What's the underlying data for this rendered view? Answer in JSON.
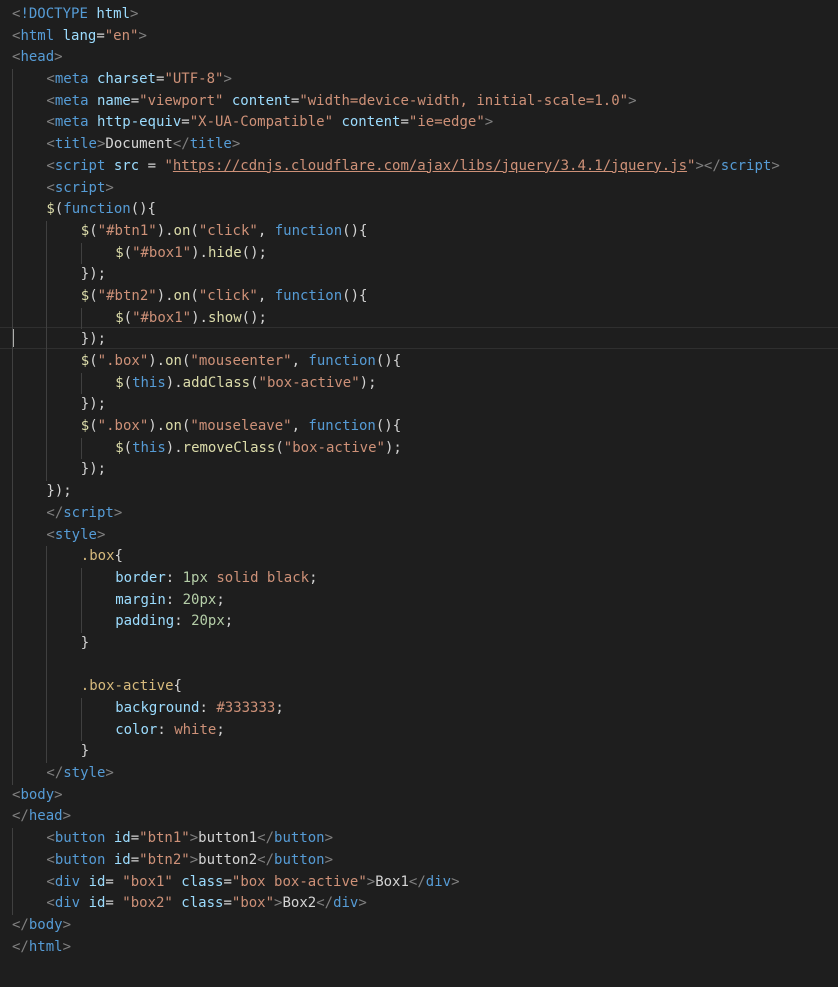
{
  "editor": {
    "language": "html",
    "theme_colors": {
      "background": "#1e1e1e",
      "tag": "#569cd6",
      "bracket": "#808080",
      "attribute": "#9cdcfe",
      "string": "#ce9178",
      "function": "#dcdcaa",
      "keyword": "#569cd6",
      "selector": "#d7ba7d",
      "number": "#b5cea8",
      "text": "#d4d4d4"
    },
    "lines": [
      {
        "indent": 0,
        "tokens": [
          [
            "brk",
            "<"
          ],
          [
            "doc",
            "!DOCTYPE"
          ],
          [
            "txt",
            " "
          ],
          [
            "attr",
            "html"
          ],
          [
            "brk",
            ">"
          ]
        ]
      },
      {
        "indent": 0,
        "tokens": [
          [
            "brk",
            "<"
          ],
          [
            "tag",
            "html"
          ],
          [
            "txt",
            " "
          ],
          [
            "attr",
            "lang"
          ],
          [
            "punc",
            "="
          ],
          [
            "str",
            "\"en\""
          ],
          [
            "brk",
            ">"
          ]
        ]
      },
      {
        "indent": 0,
        "tokens": [
          [
            "brk",
            "<"
          ],
          [
            "tag",
            "head"
          ],
          [
            "brk",
            ">"
          ]
        ]
      },
      {
        "indent": 1,
        "tokens": [
          [
            "brk",
            "<"
          ],
          [
            "tag",
            "meta"
          ],
          [
            "txt",
            " "
          ],
          [
            "attr",
            "charset"
          ],
          [
            "punc",
            "="
          ],
          [
            "str",
            "\"UTF-8\""
          ],
          [
            "brk",
            ">"
          ]
        ]
      },
      {
        "indent": 1,
        "tokens": [
          [
            "brk",
            "<"
          ],
          [
            "tag",
            "meta"
          ],
          [
            "txt",
            " "
          ],
          [
            "attr",
            "name"
          ],
          [
            "punc",
            "="
          ],
          [
            "str",
            "\"viewport\""
          ],
          [
            "txt",
            " "
          ],
          [
            "attr",
            "content"
          ],
          [
            "punc",
            "="
          ],
          [
            "str",
            "\"width=device-width, initial-scale=1.0\""
          ],
          [
            "brk",
            ">"
          ]
        ]
      },
      {
        "indent": 1,
        "tokens": [
          [
            "brk",
            "<"
          ],
          [
            "tag",
            "meta"
          ],
          [
            "txt",
            " "
          ],
          [
            "attr",
            "http-equiv"
          ],
          [
            "punc",
            "="
          ],
          [
            "str",
            "\"X-UA-Compatible\""
          ],
          [
            "txt",
            " "
          ],
          [
            "attr",
            "content"
          ],
          [
            "punc",
            "="
          ],
          [
            "str",
            "\"ie=edge\""
          ],
          [
            "brk",
            ">"
          ]
        ]
      },
      {
        "indent": 1,
        "tokens": [
          [
            "brk",
            "<"
          ],
          [
            "tag",
            "title"
          ],
          [
            "brk",
            ">"
          ],
          [
            "txt",
            "Document"
          ],
          [
            "brk",
            "</"
          ],
          [
            "tag",
            "title"
          ],
          [
            "brk",
            ">"
          ]
        ]
      },
      {
        "indent": 1,
        "tokens": [
          [
            "brk",
            "<"
          ],
          [
            "tag",
            "script"
          ],
          [
            "txt",
            " "
          ],
          [
            "attr",
            "src"
          ],
          [
            "txt",
            " = "
          ],
          [
            "str",
            "\""
          ],
          [
            "link",
            "https://cdnjs.cloudflare.com/ajax/libs/jquery/3.4.1/jquery.js"
          ],
          [
            "str",
            "\""
          ],
          [
            "brk",
            "></"
          ],
          [
            "tag",
            "script"
          ],
          [
            "brk",
            ">"
          ]
        ]
      },
      {
        "indent": 1,
        "tokens": [
          [
            "brk",
            "<"
          ],
          [
            "tag",
            "script"
          ],
          [
            "brk",
            ">"
          ]
        ]
      },
      {
        "indent": 1,
        "tokens": [
          [
            "fn",
            "$"
          ],
          [
            "punc",
            "("
          ],
          [
            "kw",
            "function"
          ],
          [
            "punc",
            "(){"
          ]
        ]
      },
      {
        "indent": 2,
        "tokens": [
          [
            "fn",
            "$"
          ],
          [
            "punc",
            "("
          ],
          [
            "str",
            "\"#btn1\""
          ],
          [
            "punc",
            ")."
          ],
          [
            "fn",
            "on"
          ],
          [
            "punc",
            "("
          ],
          [
            "str",
            "\"click\""
          ],
          [
            "punc",
            ", "
          ],
          [
            "kw",
            "function"
          ],
          [
            "punc",
            "(){"
          ]
        ]
      },
      {
        "indent": 3,
        "tokens": [
          [
            "fn",
            "$"
          ],
          [
            "punc",
            "("
          ],
          [
            "str",
            "\"#box1\""
          ],
          [
            "punc",
            ")."
          ],
          [
            "fn",
            "hide"
          ],
          [
            "punc",
            "();"
          ]
        ]
      },
      {
        "indent": 2,
        "tokens": [
          [
            "punc",
            "});"
          ]
        ]
      },
      {
        "indent": 2,
        "tokens": [
          [
            "fn",
            "$"
          ],
          [
            "punc",
            "("
          ],
          [
            "str",
            "\"#btn2\""
          ],
          [
            "punc",
            ")."
          ],
          [
            "fn",
            "on"
          ],
          [
            "punc",
            "("
          ],
          [
            "str",
            "\"click\""
          ],
          [
            "punc",
            ", "
          ],
          [
            "kw",
            "function"
          ],
          [
            "punc",
            "(){"
          ]
        ]
      },
      {
        "indent": 3,
        "tokens": [
          [
            "fn",
            "$"
          ],
          [
            "punc",
            "("
          ],
          [
            "str",
            "\"#box1\""
          ],
          [
            "punc",
            ")."
          ],
          [
            "fn",
            "show"
          ],
          [
            "punc",
            "();"
          ]
        ]
      },
      {
        "indent": 2,
        "tokens": [
          [
            "punc",
            "});"
          ]
        ]
      },
      {
        "indent": 2,
        "tokens": [
          [
            "fn",
            "$"
          ],
          [
            "punc",
            "("
          ],
          [
            "str",
            "\".box\""
          ],
          [
            "punc",
            ")."
          ],
          [
            "fn",
            "on"
          ],
          [
            "punc",
            "("
          ],
          [
            "str",
            "\"mouseenter\""
          ],
          [
            "punc",
            ", "
          ],
          [
            "kw",
            "function"
          ],
          [
            "punc",
            "(){"
          ]
        ]
      },
      {
        "indent": 3,
        "tokens": [
          [
            "fn",
            "$"
          ],
          [
            "punc",
            "("
          ],
          [
            "kw",
            "this"
          ],
          [
            "punc",
            ")."
          ],
          [
            "fn",
            "addClass"
          ],
          [
            "punc",
            "("
          ],
          [
            "str",
            "\"box-active\""
          ],
          [
            "punc",
            ");"
          ]
        ]
      },
      {
        "indent": 2,
        "tokens": [
          [
            "punc",
            "});"
          ]
        ]
      },
      {
        "indent": 2,
        "tokens": [
          [
            "fn",
            "$"
          ],
          [
            "punc",
            "("
          ],
          [
            "str",
            "\".box\""
          ],
          [
            "punc",
            ")."
          ],
          [
            "fn",
            "on"
          ],
          [
            "punc",
            "("
          ],
          [
            "str",
            "\"mouseleave\""
          ],
          [
            "punc",
            ", "
          ],
          [
            "kw",
            "function"
          ],
          [
            "punc",
            "(){"
          ]
        ]
      },
      {
        "indent": 3,
        "tokens": [
          [
            "fn",
            "$"
          ],
          [
            "punc",
            "("
          ],
          [
            "kw",
            "this"
          ],
          [
            "punc",
            ")."
          ],
          [
            "fn",
            "removeClass"
          ],
          [
            "punc",
            "("
          ],
          [
            "str",
            "\"box-active\""
          ],
          [
            "punc",
            ");"
          ]
        ]
      },
      {
        "indent": 2,
        "tokens": [
          [
            "punc",
            "});"
          ]
        ]
      },
      {
        "indent": 1,
        "tokens": [
          [
            "punc",
            "});"
          ]
        ]
      },
      {
        "indent": 1,
        "tokens": [
          [
            "brk",
            "</"
          ],
          [
            "tag",
            "script"
          ],
          [
            "brk",
            ">"
          ]
        ]
      },
      {
        "indent": 1,
        "tokens": [
          [
            "brk",
            "<"
          ],
          [
            "tag",
            "style"
          ],
          [
            "brk",
            ">"
          ]
        ]
      },
      {
        "indent": 2,
        "tokens": [
          [
            "sel",
            ".box"
          ],
          [
            "punc",
            "{"
          ]
        ]
      },
      {
        "indent": 3,
        "tokens": [
          [
            "prop",
            "border"
          ],
          [
            "punc",
            ": "
          ],
          [
            "num",
            "1px"
          ],
          [
            "val",
            " solid black"
          ],
          [
            "punc",
            ";"
          ]
        ]
      },
      {
        "indent": 3,
        "tokens": [
          [
            "prop",
            "margin"
          ],
          [
            "punc",
            ": "
          ],
          [
            "num",
            "20px"
          ],
          [
            "punc",
            ";"
          ]
        ]
      },
      {
        "indent": 3,
        "tokens": [
          [
            "prop",
            "padding"
          ],
          [
            "punc",
            ": "
          ],
          [
            "num",
            "20px"
          ],
          [
            "punc",
            ";"
          ]
        ]
      },
      {
        "indent": 2,
        "tokens": [
          [
            "punc",
            "}"
          ]
        ]
      },
      {
        "indent": 2,
        "tokens": []
      },
      {
        "indent": 2,
        "tokens": [
          [
            "sel",
            ".box-active"
          ],
          [
            "punc",
            "{"
          ]
        ]
      },
      {
        "indent": 3,
        "tokens": [
          [
            "prop",
            "background"
          ],
          [
            "punc",
            ": "
          ],
          [
            "val",
            "#333333"
          ],
          [
            "punc",
            ";"
          ]
        ]
      },
      {
        "indent": 3,
        "tokens": [
          [
            "prop",
            "color"
          ],
          [
            "punc",
            ": "
          ],
          [
            "val",
            "white"
          ],
          [
            "punc",
            ";"
          ]
        ]
      },
      {
        "indent": 2,
        "tokens": [
          [
            "punc",
            "}"
          ]
        ]
      },
      {
        "indent": 1,
        "tokens": [
          [
            "brk",
            "</"
          ],
          [
            "tag",
            "style"
          ],
          [
            "brk",
            ">"
          ]
        ]
      },
      {
        "indent": 0,
        "tokens": [
          [
            "brk",
            "<"
          ],
          [
            "tag",
            "body"
          ],
          [
            "brk",
            ">"
          ]
        ]
      },
      {
        "indent": 0,
        "tokens": [
          [
            "brk",
            "</"
          ],
          [
            "tag",
            "head"
          ],
          [
            "brk",
            ">"
          ]
        ]
      },
      {
        "indent": 1,
        "tokens": [
          [
            "brk",
            "<"
          ],
          [
            "tag",
            "button"
          ],
          [
            "txt",
            " "
          ],
          [
            "attr",
            "id"
          ],
          [
            "punc",
            "="
          ],
          [
            "str",
            "\"btn1\""
          ],
          [
            "brk",
            ">"
          ],
          [
            "txt",
            "button1"
          ],
          [
            "brk",
            "</"
          ],
          [
            "tag",
            "button"
          ],
          [
            "brk",
            ">"
          ]
        ]
      },
      {
        "indent": 1,
        "tokens": [
          [
            "brk",
            "<"
          ],
          [
            "tag",
            "button"
          ],
          [
            "txt",
            " "
          ],
          [
            "attr",
            "id"
          ],
          [
            "punc",
            "="
          ],
          [
            "str",
            "\"btn2\""
          ],
          [
            "brk",
            ">"
          ],
          [
            "txt",
            "button2"
          ],
          [
            "brk",
            "</"
          ],
          [
            "tag",
            "button"
          ],
          [
            "brk",
            ">"
          ]
        ]
      },
      {
        "indent": 1,
        "tokens": [
          [
            "brk",
            "<"
          ],
          [
            "tag",
            "div"
          ],
          [
            "txt",
            " "
          ],
          [
            "attr",
            "id"
          ],
          [
            "punc",
            "= "
          ],
          [
            "str",
            "\"box1\""
          ],
          [
            "txt",
            " "
          ],
          [
            "attr",
            "class"
          ],
          [
            "punc",
            "="
          ],
          [
            "str",
            "\"box box-active\""
          ],
          [
            "brk",
            ">"
          ],
          [
            "txt",
            "Box1"
          ],
          [
            "brk",
            "</"
          ],
          [
            "tag",
            "div"
          ],
          [
            "brk",
            ">"
          ]
        ]
      },
      {
        "indent": 1,
        "tokens": [
          [
            "brk",
            "<"
          ],
          [
            "tag",
            "div"
          ],
          [
            "txt",
            " "
          ],
          [
            "attr",
            "id"
          ],
          [
            "punc",
            "= "
          ],
          [
            "str",
            "\"box2\""
          ],
          [
            "txt",
            " "
          ],
          [
            "attr",
            "class"
          ],
          [
            "punc",
            "="
          ],
          [
            "str",
            "\"box\""
          ],
          [
            "brk",
            ">"
          ],
          [
            "txt",
            "Box2"
          ],
          [
            "brk",
            "</"
          ],
          [
            "tag",
            "div"
          ],
          [
            "brk",
            ">"
          ]
        ]
      },
      {
        "indent": 0,
        "tokens": [
          [
            "brk",
            "</"
          ],
          [
            "tag",
            "body"
          ],
          [
            "brk",
            ">"
          ]
        ]
      },
      {
        "indent": 0,
        "tokens": [
          [
            "brk",
            "</"
          ],
          [
            "tag",
            "html"
          ],
          [
            "brk",
            ">"
          ]
        ]
      }
    ]
  }
}
